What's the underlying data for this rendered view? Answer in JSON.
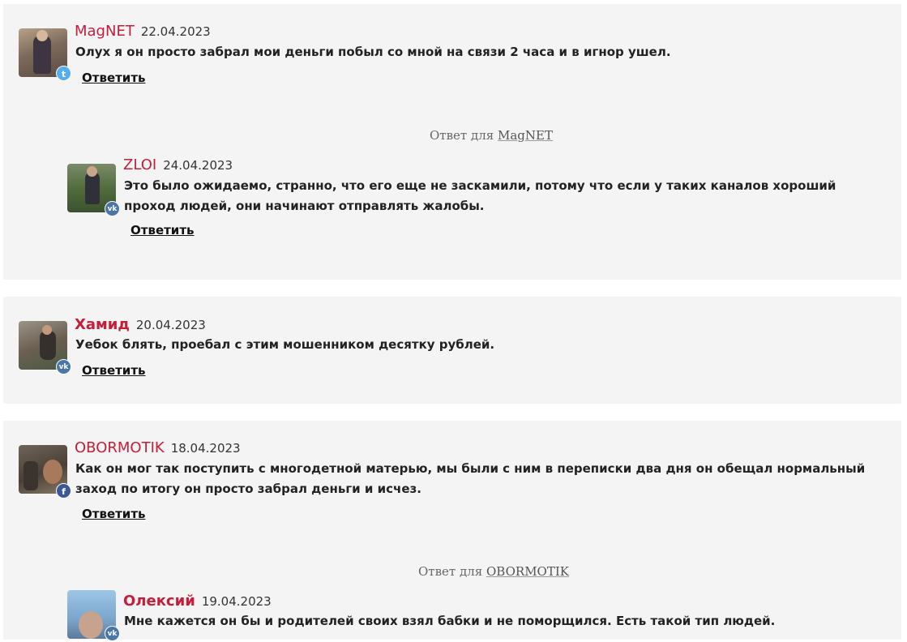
{
  "colors": {
    "name_accent": "#c41e3a",
    "vk": "#4a76a8",
    "twitter": "#55acee",
    "facebook": "#3b5998"
  },
  "reply_label": "Ответить",
  "answer_prefix": "Ответ для",
  "comments": [
    {
      "name": "MagNET",
      "date": "22.04.2023",
      "network": "twitter-icon",
      "text": "Олух я он просто забрал мои деньги побыл со мной на связи 2 часа и в игнор ушел."
    },
    {
      "answer_to": "MagNET",
      "name": "ZLOI",
      "date": "24.04.2023",
      "network": "vk-icon",
      "text": "Это было ожидаемо, странно, что его еще не заскамили, потому что если у таких каналов хороший проход людей, они начинают отправлять жалобы."
    },
    {
      "name": "Хамид",
      "date": "20.04.2023",
      "network": "vk-icon",
      "text": "Уебок блять, проебал с этим мошенником десятку рублей."
    },
    {
      "name": "OBORMOTIK",
      "date": "18.04.2023",
      "network": "facebook-icon",
      "text": "Как он мог так поступить с многодетной матерью, мы были с ним в переписки два дня он обещал нормальный заход по итогу он просто забрал деньги и исчез."
    },
    {
      "answer_to": "OBORMOTIK",
      "name": "Олексий",
      "date": "19.04.2023",
      "network": "vk-icon",
      "text": "Мне кажется он бы и родителей своих взял бабки и не поморщился. Есть такой тип людей."
    }
  ]
}
